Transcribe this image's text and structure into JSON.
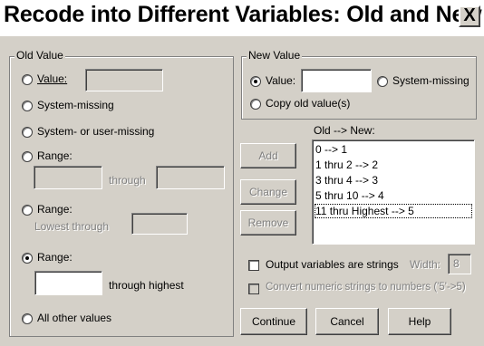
{
  "window": {
    "title": "Recode into Different Variables: Old and New ...",
    "close_glyph": "X"
  },
  "old_value": {
    "legend": "Old Value",
    "value_label": "Value:",
    "system_missing": "System-missing",
    "system_or_user_missing": "System- or user-missing",
    "range1_label": "Range:",
    "range1_through": "through",
    "range2_label": "Range:",
    "range2_lowest": "Lowest through",
    "range3_label": "Range:",
    "range3_highest": "through highest",
    "all_other": "All other values",
    "selected": "range3"
  },
  "new_value": {
    "legend": "New Value",
    "value_label": "Value:",
    "system_missing": "System-missing",
    "copy_old": "Copy old value(s)",
    "selected": "value"
  },
  "mapping": {
    "label": "Old --> New:",
    "items": [
      "0 --> 1",
      "1 thru 2 --> 2",
      "3 thru 4 --> 3",
      "5 thru 10 --> 4",
      "11 thru Highest --> 5"
    ]
  },
  "side_buttons": {
    "add": "Add",
    "change": "Change",
    "remove": "Remove"
  },
  "options": {
    "output_strings": "Output variables are strings",
    "width_label": "Width:",
    "width_value": "8",
    "convert_numeric": "Convert numeric strings to numbers ('5'->5)"
  },
  "buttons": {
    "continue": "Continue",
    "cancel": "Cancel",
    "help": "Help"
  }
}
